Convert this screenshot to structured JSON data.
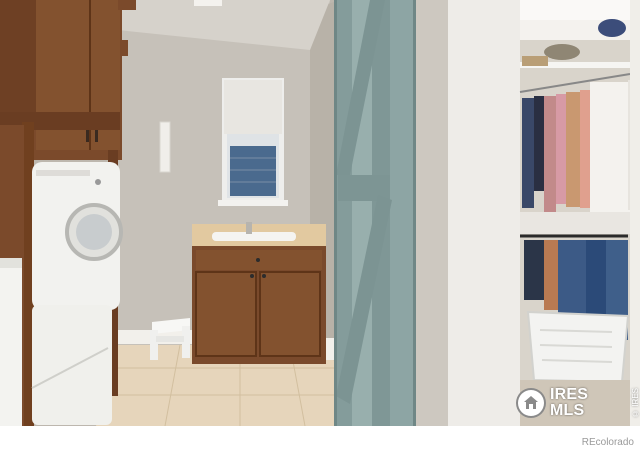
{
  "photo": {
    "description_name": "laundry-room-with-walk-in-closet",
    "colors": {
      "wall": "#c9c3ba",
      "cabinet": "#7a4a2c",
      "barn_door": "#8fa7a6",
      "floor": "#e8d7bd",
      "countertop": "#e2c9a0",
      "washer": "#f1f1ee"
    }
  },
  "watermark": {
    "brand": "IRES",
    "sub": "MLS",
    "side": "© IRES",
    "line": "IRES MLS",
    "footer": "REcolorado"
  }
}
